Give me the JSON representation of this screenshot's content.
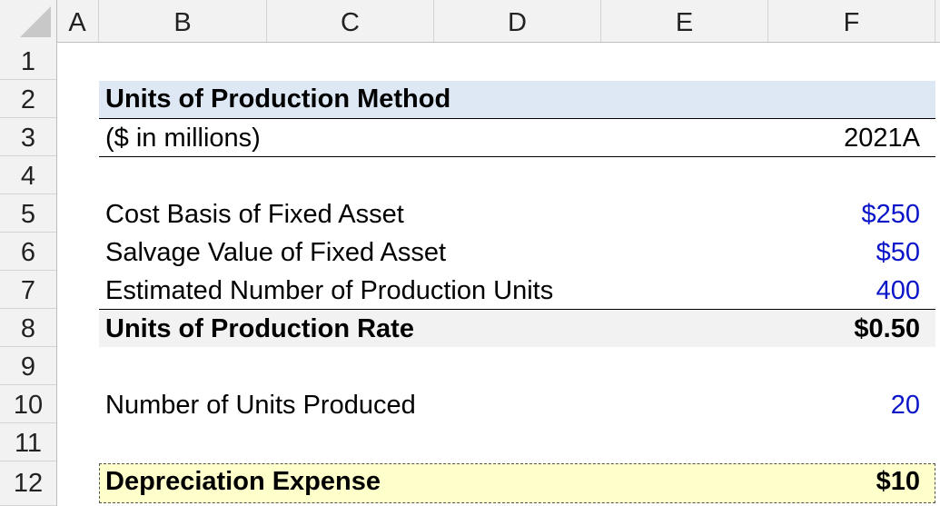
{
  "columns": [
    "A",
    "B",
    "C",
    "D",
    "E",
    "F"
  ],
  "rows": [
    "1",
    "2",
    "3",
    "4",
    "5",
    "6",
    "7",
    "8",
    "9",
    "10",
    "11",
    "12"
  ],
  "title": "Units of Production Method",
  "units_label": "($ in millions)",
  "period": "2021A",
  "items": [
    {
      "label": "Cost Basis of Fixed Asset",
      "value": "$250"
    },
    {
      "label": "Salvage Value of Fixed Asset",
      "value": "$50"
    },
    {
      "label": "Estimated Number of Production Units",
      "value": "400"
    }
  ],
  "rate": {
    "label": "Units of Production Rate",
    "value": "$0.50"
  },
  "units_produced": {
    "label": "Number of Units Produced",
    "value": "20"
  },
  "depreciation": {
    "label": "Depreciation Expense",
    "value": "$10"
  },
  "colors": {
    "input_blue": "#0a14c8",
    "header_band": "#dde8f4",
    "rate_band": "#f2f2f2",
    "result_band": "#ffffcc"
  }
}
